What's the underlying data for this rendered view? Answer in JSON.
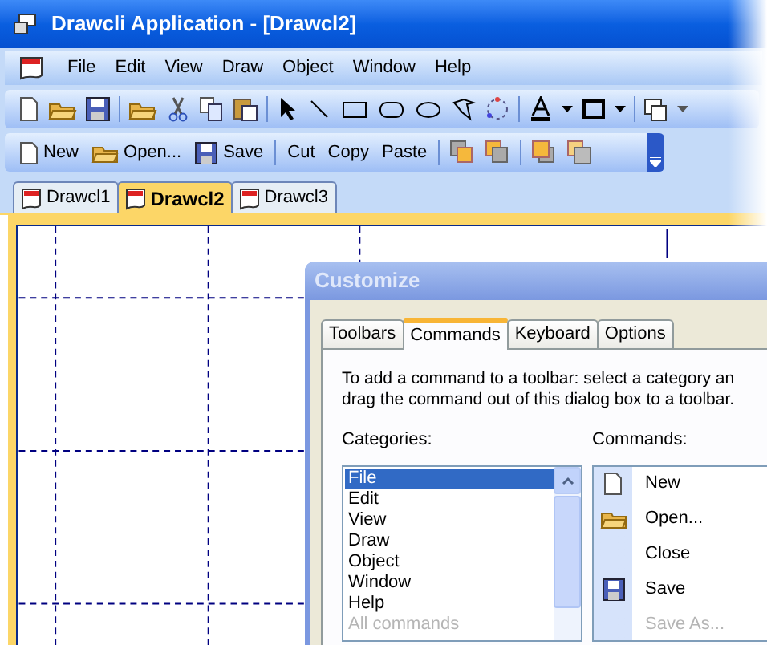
{
  "window": {
    "title": "Drawcli Application - [Drawcl2]"
  },
  "menu": [
    "File",
    "Edit",
    "View",
    "Draw",
    "Object",
    "Window",
    "Help"
  ],
  "toolbar_2": [
    {
      "kind": "new",
      "label": "New"
    },
    {
      "kind": "open",
      "label": "Open..."
    },
    {
      "kind": "save",
      "label": "Save"
    },
    {
      "kind": "separator"
    },
    {
      "kind": "text",
      "label": "Cut"
    },
    {
      "kind": "text",
      "label": "Copy"
    },
    {
      "kind": "text",
      "label": "Paste"
    }
  ],
  "document_tabs": [
    {
      "label": "Drawcl1",
      "selected": false
    },
    {
      "label": "Drawcl2",
      "selected": true
    },
    {
      "label": "Drawcl3",
      "selected": false
    }
  ],
  "dialog": {
    "title": "Customize",
    "tabs": [
      {
        "label": "Toolbars",
        "selected": false
      },
      {
        "label": "Commands",
        "selected": true
      },
      {
        "label": "Keyboard",
        "selected": false
      },
      {
        "label": "Options",
        "selected": false
      }
    ],
    "instructions": [
      "To add a command to a toolbar: select a category an",
      "drag the command out of this dialog box to a toolbar."
    ],
    "categories_label": "Categories:",
    "categories": [
      {
        "label": "File",
        "selected": true,
        "disabled": false
      },
      {
        "label": "Edit",
        "selected": false,
        "disabled": false
      },
      {
        "label": "View",
        "selected": false,
        "disabled": false
      },
      {
        "label": "Draw",
        "selected": false,
        "disabled": false
      },
      {
        "label": "Object",
        "selected": false,
        "disabled": false
      },
      {
        "label": "Window",
        "selected": false,
        "disabled": false
      },
      {
        "label": "Help",
        "selected": false,
        "disabled": false
      },
      {
        "label": "All commands",
        "selected": false,
        "disabled": true
      }
    ],
    "commands_label": "Commands:",
    "commands": [
      {
        "kind": "new",
        "label": "New",
        "disabled": false
      },
      {
        "kind": "open",
        "label": "Open...",
        "disabled": false
      },
      {
        "kind": "plain",
        "label": "Close",
        "disabled": false
      },
      {
        "kind": "save",
        "label": "Save",
        "disabled": false
      },
      {
        "kind": "plain",
        "label": "Save As...",
        "disabled": true
      }
    ]
  }
}
